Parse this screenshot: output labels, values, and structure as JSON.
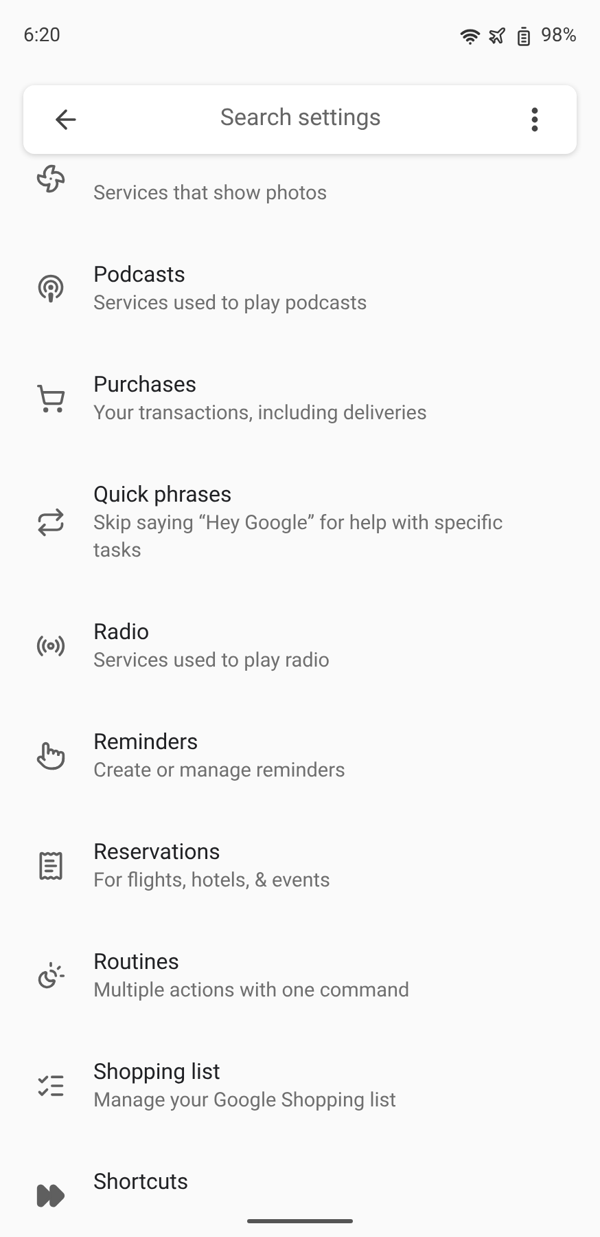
{
  "status_bar": {
    "time": "6:20",
    "battery": "98%"
  },
  "search_bar": {
    "placeholder": "Search settings"
  },
  "items": [
    {
      "subtitle": "Services that show photos"
    },
    {
      "title": "Podcasts",
      "subtitle": "Services used to play podcasts"
    },
    {
      "title": "Purchases",
      "subtitle": "Your transactions, including deliveries"
    },
    {
      "title": "Quick phrases",
      "subtitle": "Skip saying “Hey Google” for help with specific tasks"
    },
    {
      "title": "Radio",
      "subtitle": "Services used to play radio"
    },
    {
      "title": "Reminders",
      "subtitle": "Create or manage reminders"
    },
    {
      "title": "Reservations",
      "subtitle": "For flights, hotels, & events"
    },
    {
      "title": "Routines",
      "subtitle": "Multiple actions with one command"
    },
    {
      "title": "Shopping list",
      "subtitle": "Manage your Google Shopping list"
    },
    {
      "title": "Shortcuts"
    }
  ]
}
